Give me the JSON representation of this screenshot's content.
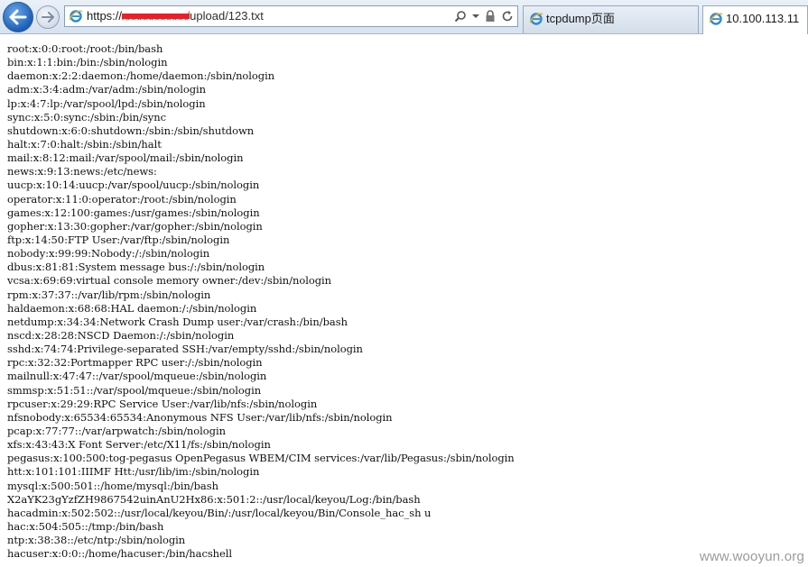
{
  "browser": {
    "address_bar": {
      "url_scheme": "https://",
      "url_redacted": "xxxxxxxxxxx/",
      "url_path": "upload/123.txt"
    },
    "tabs": [
      {
        "label": "tcpdump页面",
        "active": false
      },
      {
        "label": "10.100.113.11",
        "active": true
      }
    ],
    "icons": {
      "back": "back-arrow-icon",
      "forward": "forward-arrow-icon",
      "page": "ie-page-icon",
      "search": "search-icon",
      "dropdown": "chevron-down-icon",
      "lock": "lock-icon",
      "refresh": "refresh-icon"
    },
    "colors": {
      "accent": "#1c5fb8",
      "redaction": "#e8202a"
    }
  },
  "page": {
    "lines": [
      "root:x:0:0:root:/root:/bin/bash",
      "bin:x:1:1:bin:/bin:/sbin/nologin",
      "daemon:x:2:2:daemon:/home/daemon:/sbin/nologin",
      "adm:x:3:4:adm:/var/adm:/sbin/nologin",
      "lp:x:4:7:lp:/var/spool/lpd:/sbin/nologin",
      "sync:x:5:0:sync:/sbin:/bin/sync",
      "shutdown:x:6:0:shutdown:/sbin:/sbin/shutdown",
      "halt:x:7:0:halt:/sbin:/sbin/halt",
      "mail:x:8:12:mail:/var/spool/mail:/sbin/nologin",
      "news:x:9:13:news:/etc/news:",
      "uucp:x:10:14:uucp:/var/spool/uucp:/sbin/nologin",
      "operator:x:11:0:operator:/root:/sbin/nologin",
      "games:x:12:100:games:/usr/games:/sbin/nologin",
      "gopher:x:13:30:gopher:/var/gopher:/sbin/nologin",
      "ftp:x:14:50:FTP User:/var/ftp:/sbin/nologin",
      "nobody:x:99:99:Nobody:/:/sbin/nologin",
      "dbus:x:81:81:System message bus:/:/sbin/nologin",
      "vcsa:x:69:69:virtual console memory owner:/dev:/sbin/nologin",
      "rpm:x:37:37::/var/lib/rpm:/sbin/nologin",
      "haldaemon:x:68:68:HAL daemon:/:/sbin/nologin",
      "netdump:x:34:34:Network Crash Dump user:/var/crash:/bin/bash",
      "nscd:x:28:28:NSCD Daemon:/:/sbin/nologin",
      "sshd:x:74:74:Privilege-separated SSH:/var/empty/sshd:/sbin/nologin",
      "rpc:x:32:32:Portmapper RPC user:/:/sbin/nologin",
      "mailnull:x:47:47::/var/spool/mqueue:/sbin/nologin",
      "smmsp:x:51:51::/var/spool/mqueue:/sbin/nologin",
      "rpcuser:x:29:29:RPC Service User:/var/lib/nfs:/sbin/nologin",
      "nfsnobody:x:65534:65534:Anonymous NFS User:/var/lib/nfs:/sbin/nologin",
      "pcap:x:77:77::/var/arpwatch:/sbin/nologin",
      "xfs:x:43:43:X Font Server:/etc/X11/fs:/sbin/nologin",
      "pegasus:x:100:500:tog-pegasus OpenPegasus WBEM/CIM services:/var/lib/Pegasus:/sbin/nologin",
      "htt:x:101:101:IIIMF Htt:/usr/lib/im:/sbin/nologin",
      "mysql:x:500:501::/home/mysql:/bin/bash",
      "X2aYK23gYzfZH9867542uinAnU2Hx86:x:501:2::/usr/local/keyou/Log:/bin/bash",
      "hacadmin:x:502:502::/usr/local/keyou/Bin/:/usr/local/keyou/Bin/Console_hac_sh u",
      "hac:x:504:505::/tmp:/bin/bash",
      "ntp:x:38:38::/etc/ntp:/sbin/nologin",
      "hacuser:x:0:0::/home/hacuser:/bin/hacshell"
    ]
  },
  "watermark": "www.wooyun.org"
}
